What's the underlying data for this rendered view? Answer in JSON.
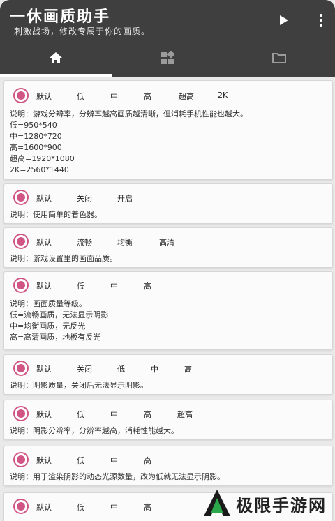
{
  "app": {
    "title": "一休画质助手",
    "subtitle": "刺激战场，修改专属于你的画质。"
  },
  "tabs": [
    {
      "icon": "home-icon",
      "active": true
    },
    {
      "icon": "widgets-icon",
      "active": false
    },
    {
      "icon": "folder-icon",
      "active": false
    }
  ],
  "cards": [
    {
      "options": [
        "默认",
        "低",
        "中",
        "高",
        "超高",
        "2K"
      ],
      "description": [
        "说明：游戏分辨率，分辨率越高画质越清晰，但消耗手机性能也越大。",
        "低=950*540",
        "中=1280*720",
        "高=1600*900",
        "超高=1920*1080",
        "2K=2560*1440"
      ]
    },
    {
      "options": [
        "默认",
        "关闭",
        "开启"
      ],
      "description": [
        "说明：使用简单的着色器。"
      ]
    },
    {
      "options": [
        "默认",
        "流畅",
        "均衡",
        "高清"
      ],
      "description": [
        "说明：游戏设置里的画面品质。"
      ]
    },
    {
      "options": [
        "默认",
        "低",
        "中",
        "高"
      ],
      "description": [
        "说明：画面质量等级。",
        "低=流畅画质，无法显示阴影",
        "中=均衡画质，无反光",
        "高=高清画质，地板有反光"
      ]
    },
    {
      "options": [
        "默认",
        "关闭",
        "低",
        "中",
        "高"
      ],
      "description": [
        "说明：阴影质量，关闭后无法显示阴影。"
      ]
    },
    {
      "options": [
        "默认",
        "低",
        "中",
        "高",
        "超高"
      ],
      "description": [
        "说明：阴影分辨率，分辨率越高，消耗性能越大。"
      ]
    },
    {
      "options": [
        "默认",
        "低",
        "中",
        "高"
      ],
      "description": [
        "说明：用于渲染阴影的动态光源数量，改为低就无法显示阴影。"
      ]
    },
    {
      "options": [
        "默认",
        "低",
        "中",
        "高"
      ],
      "description": []
    }
  ],
  "watermark": {
    "text": "极限手游网"
  },
  "colors": {
    "appbar": "#3f3f3f",
    "accent": "#d05585",
    "background": "#e9e9e9"
  }
}
